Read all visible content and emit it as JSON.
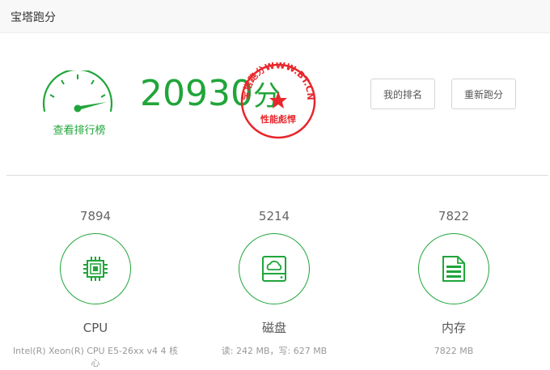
{
  "window": {
    "title": "宝塔跑分"
  },
  "summary": {
    "total_score": "20930",
    "score_unit": "分",
    "rank_link": "查看排行榜"
  },
  "stamp": {
    "arc_text": "宝塔跑分WWW.BT.CN",
    "bottom_text": "性能彪悍",
    "color": "#e8262b"
  },
  "buttons": {
    "my_rank": "我的排名",
    "rerun": "重新跑分"
  },
  "categories": [
    {
      "score": "7894",
      "name": "CPU",
      "detail": "Intel(R) Xeon(R) CPU E5-26xx v4 4 核心",
      "icon": "cpu-chip-icon"
    },
    {
      "score": "5214",
      "name": "磁盘",
      "detail": "读: 242 MB，写: 627 MB",
      "icon": "cloud-disk-icon"
    },
    {
      "score": "7822",
      "name": "内存",
      "detail": "7822 MB",
      "icon": "memory-document-icon"
    }
  ],
  "colors": {
    "accent": "#20a53a",
    "stamp_red": "#e8262b"
  }
}
